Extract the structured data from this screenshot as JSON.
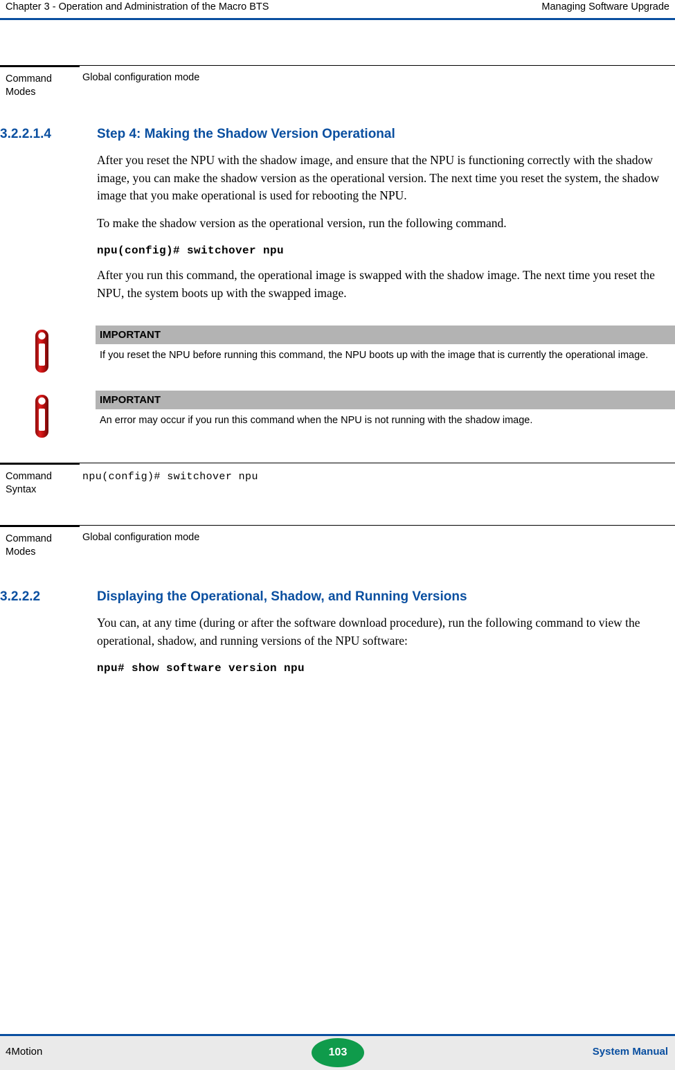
{
  "header": {
    "left": "Chapter 3 - Operation and Administration of the Macro BTS",
    "right": "Managing Software Upgrade"
  },
  "blocks": {
    "cmd_modes_label": "Command Modes",
    "cmd_modes_label_line1": "Command",
    "cmd_modes_label_line2": "Modes",
    "cmd_modes_value": "Global configuration mode",
    "cmd_syntax_label_line1": "Command",
    "cmd_syntax_label_line2": "Syntax",
    "cmd_syntax_value": "npu(config)# switchover npu"
  },
  "section_3_2_2_1_4": {
    "number": "3.2.2.1.4",
    "title": "Step 4: Making the Shadow Version Operational",
    "para1": "After you reset the NPU with the shadow image, and ensure that the NPU is functioning correctly with the shadow image, you can make the shadow version as the operational version. The next time you reset the system, the shadow image that you make operational is used for rebooting the NPU.",
    "para2": "To make the shadow version as the operational version, run the following command.",
    "code1": "npu(config)# switchover npu",
    "para3": "After you run this command, the operational image is swapped with the shadow image. The next time you reset the NPU, the system boots up with the swapped image."
  },
  "notes": [
    {
      "title": "IMPORTANT",
      "text": "If you reset the NPU before running this command, the NPU boots up with the image that is currently the operational image."
    },
    {
      "title": "IMPORTANT",
      "text": "An error may occur if you run this command when the NPU is not running with the shadow image."
    }
  ],
  "section_3_2_2_2": {
    "number": "3.2.2.2",
    "title": "Displaying the Operational, Shadow, and Running Versions",
    "para1": "You can, at any time (during or after the software download procedure), run the following command to view the operational, shadow, and running versions of the NPU software:",
    "code1": "npu# show software version npu"
  },
  "footer": {
    "left": "4Motion",
    "page": "103",
    "right": "System Manual"
  },
  "colors": {
    "accent_blue": "#0a4fa0",
    "note_header_gray": "#b3b3b3",
    "footer_gray": "#eaeaea",
    "page_badge_green": "#0f9b4b"
  }
}
